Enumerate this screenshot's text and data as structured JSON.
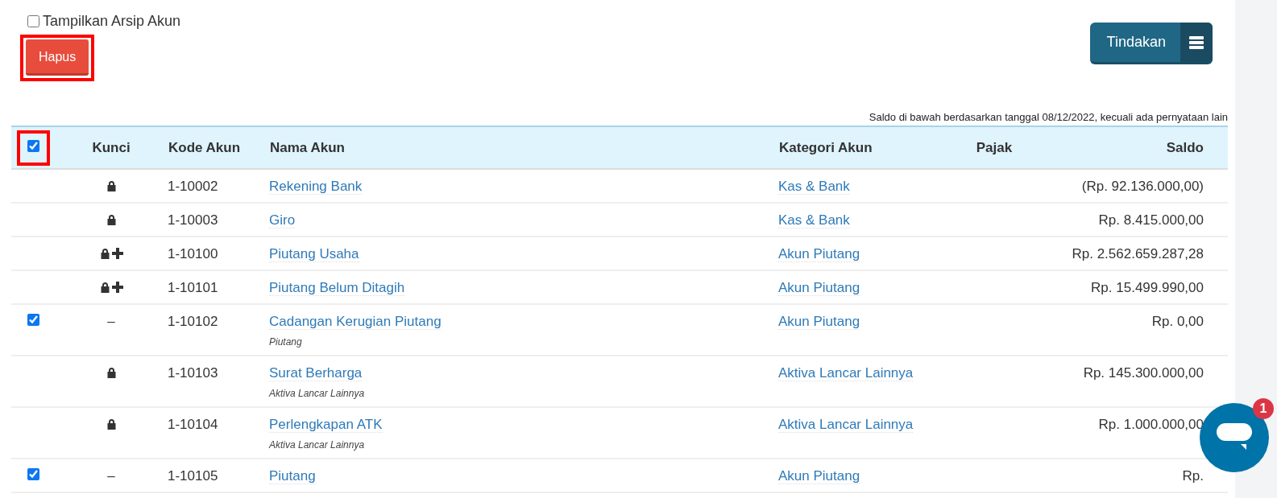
{
  "archive_toggle": {
    "label": "Tampilkan Arsip Akun",
    "checked": false
  },
  "delete_button": {
    "label": "Hapus",
    "highlighted": true
  },
  "actions_button": {
    "label": "Tindakan"
  },
  "balance_note": "Saldo di bawah berdasarkan tanggal 08/12/2022, kecuali ada pernyataan lain",
  "table": {
    "select_all": {
      "checked": true,
      "highlighted": true
    },
    "columns": [
      "Kunci",
      "Kode Akun",
      "Nama Akun",
      "Kategori Akun",
      "Pajak",
      "Saldo"
    ],
    "rows": [
      {
        "checkbox": null,
        "lock": {
          "kind": "lock"
        },
        "code": "1-10002",
        "name": "Rekening Bank",
        "category": "Kas & Bank",
        "balance": "(Rp. 92.136.000,00)"
      },
      {
        "checkbox": null,
        "lock": {
          "kind": "lock"
        },
        "code": "1-10003",
        "name": "Giro",
        "category": "Kas & Bank",
        "balance": "Rp. 8.415.000,00"
      },
      {
        "checkbox": null,
        "lock": {
          "kind": "lock-plus"
        },
        "code": "1-10100",
        "name": "Piutang Usaha",
        "category": "Akun Piutang",
        "balance": "Rp. 2.562.659.287,28"
      },
      {
        "checkbox": null,
        "lock": {
          "kind": "lock-plus"
        },
        "code": "1-10101",
        "name": "Piutang Belum Ditagih",
        "category": "Akun Piutang",
        "balance": "Rp. 15.499.990,00"
      },
      {
        "checkbox": {
          "checked": true
        },
        "lock": {
          "kind": "dash",
          "text": "–"
        },
        "code": "1-10102",
        "name": "Cadangan Kerugian Piutang",
        "subtitle": "Piutang",
        "category": "Akun Piutang",
        "balance": "Rp. 0,00"
      },
      {
        "checkbox": null,
        "lock": {
          "kind": "lock"
        },
        "code": "1-10103",
        "name": "Surat Berharga",
        "subtitle": "Aktiva Lancar Lainnya",
        "category": "Aktiva Lancar Lainnya",
        "balance": "Rp. 145.300.000,00"
      },
      {
        "checkbox": null,
        "lock": {
          "kind": "lock"
        },
        "code": "1-10104",
        "name": "Perlengkapan ATK",
        "subtitle": "Aktiva Lancar Lainnya",
        "category": "Aktiva Lancar Lainnya",
        "balance": "Rp. 1.000.000,00"
      },
      {
        "checkbox": {
          "checked": true
        },
        "lock": {
          "kind": "dash",
          "text": "–"
        },
        "code": "1-10105",
        "name": "Piutang",
        "category": "Akun Piutang",
        "balance": "Rp."
      }
    ]
  },
  "chat_widget": {
    "badge": "1"
  }
}
